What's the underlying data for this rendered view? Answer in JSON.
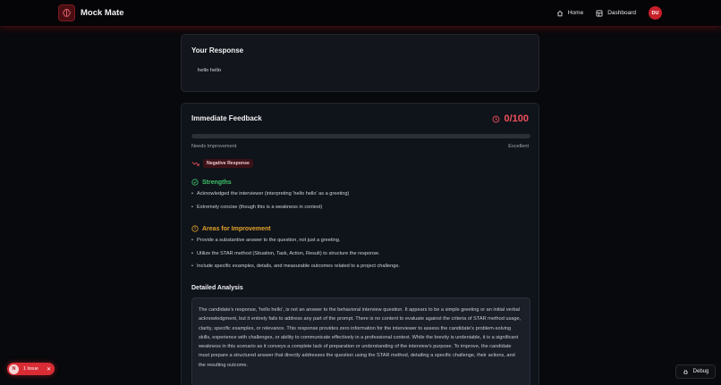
{
  "app": {
    "name": "Mock Mate"
  },
  "nav": {
    "home": "Home",
    "dashboard": "Dashboard",
    "avatar_initials": "DU"
  },
  "response": {
    "title": "Your Response",
    "text": "hello hello"
  },
  "feedback": {
    "title": "Immediate Feedback",
    "score": "0/100",
    "score_value": 0,
    "scale_low": "Needs Improvement",
    "scale_high": "Excellent",
    "sentiment": "Negative Response",
    "strengths_title": "Strengths",
    "strengths": [
      "Acknowledged the interviewer (interpreting 'hello hello' as a greeting)",
      "Extremely concise (though this is a weakness in context)"
    ],
    "improvements_title": "Areas for Improvement",
    "improvements": [
      "Provide a substantive answer to the question, not just a greeting.",
      "Utilize the STAR method (Situation, Task, Action, Result) to structure the response.",
      "Include specific examples, details, and measurable outcomes related to a project challenge."
    ],
    "analysis_title": "Detailed Analysis",
    "analysis": "The candidate's response, 'hello hello', is not an answer to the behavioral interview question. It appears to be a simple greeting or an initial verbal acknowledgment, but it entirely fails to address any part of the prompt. There is no content to evaluate against the criteria of STAR method usage, clarity, specific examples, or relevance. This response provides zero information for the interviewer to assess the candidate's problem-solving skills, experience with challenges, or ability to communicate effectively in a professional context. While the brevity is undeniable, it is a significant weakness in this scenario as it conveys a complete lack of preparation or understanding of the interview's purpose. To improve, the candidate must prepare a structured answer that directly addresses the question using the STAR method, detailing a specific challenge, their actions, and the resulting outcome."
  },
  "dev": {
    "issue_badge_letter": "N",
    "issues": "1 Issue",
    "debug": "Debug"
  },
  "colors": {
    "accent": "#e03a44",
    "strengths": "#3fc46b",
    "improvements": "#e3a42a"
  }
}
